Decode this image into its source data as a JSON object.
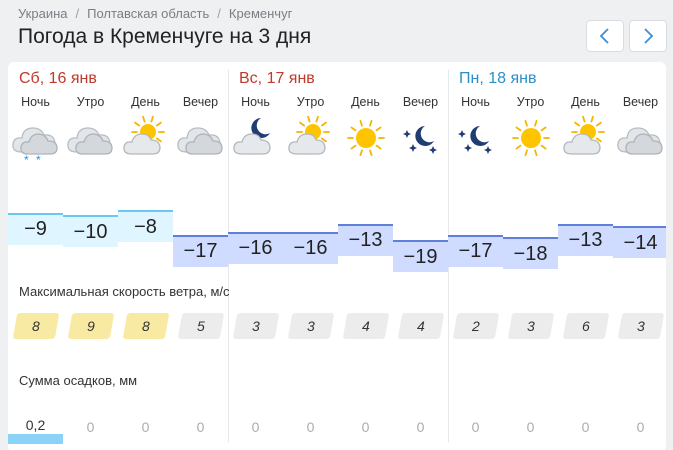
{
  "breadcrumb": [
    "Украина",
    "Полтавская область",
    "Кременчуг"
  ],
  "title": "Погода в Кременчуге на 3 дня",
  "days": [
    {
      "label": "Сб, 16 янв",
      "color": "#c0392b"
    },
    {
      "label": "Вс, 17 янв",
      "color": "#c0392b"
    },
    {
      "label": "Пн, 18 янв",
      "color": "#2a8fc9"
    }
  ],
  "periods": [
    {
      "name": "Ночь",
      "icon": "cloud-icon",
      "snow": "* *",
      "temp": "−9",
      "wind": "8",
      "prec": "0,2"
    },
    {
      "name": "Утро",
      "icon": "cloud-icon",
      "temp": "−10",
      "wind": "9",
      "prec": "0"
    },
    {
      "name": "День",
      "icon": "sun-cloud-icon",
      "temp": "−8",
      "wind": "8",
      "prec": "0"
    },
    {
      "name": "Вечер",
      "icon": "cloud-icon",
      "temp": "−17",
      "wind": "5",
      "prec": "0"
    },
    {
      "name": "Ночь",
      "icon": "moon-cloud-icon",
      "temp": "−16",
      "wind": "3",
      "prec": "0"
    },
    {
      "name": "Утро",
      "icon": "sun-cloud-icon",
      "temp": "−16",
      "wind": "3",
      "prec": "0"
    },
    {
      "name": "День",
      "icon": "sun-icon",
      "temp": "−13",
      "wind": "4",
      "prec": "0"
    },
    {
      "name": "Вечер",
      "icon": "moon-stars-icon",
      "temp": "−19",
      "wind": "4",
      "prec": "0"
    },
    {
      "name": "Ночь",
      "icon": "moon-stars-icon",
      "temp": "−17",
      "wind": "2",
      "prec": "0"
    },
    {
      "name": "Утро",
      "icon": "sun-icon",
      "temp": "−18",
      "wind": "3",
      "prec": "0"
    },
    {
      "name": "День",
      "icon": "sun-cloud-icon",
      "temp": "−13",
      "wind": "6",
      "prec": "0"
    },
    {
      "name": "Вечер",
      "icon": "cloud-icon",
      "temp": "−14",
      "wind": "3",
      "prec": "0"
    }
  ],
  "wind_title": "Максимальная скорость ветра, м/с",
  "prec_title": "Сумма осадков, мм",
  "colors": {
    "wind_strong": "#f8eaa3",
    "wind_weak": "#ececec",
    "warm_bar_fill": "#dff5ff",
    "warm_bar_line": "#6ac7ef",
    "cold_bar_fill": "#cfdcff",
    "cold_bar_line": "#5f7fd8"
  }
}
